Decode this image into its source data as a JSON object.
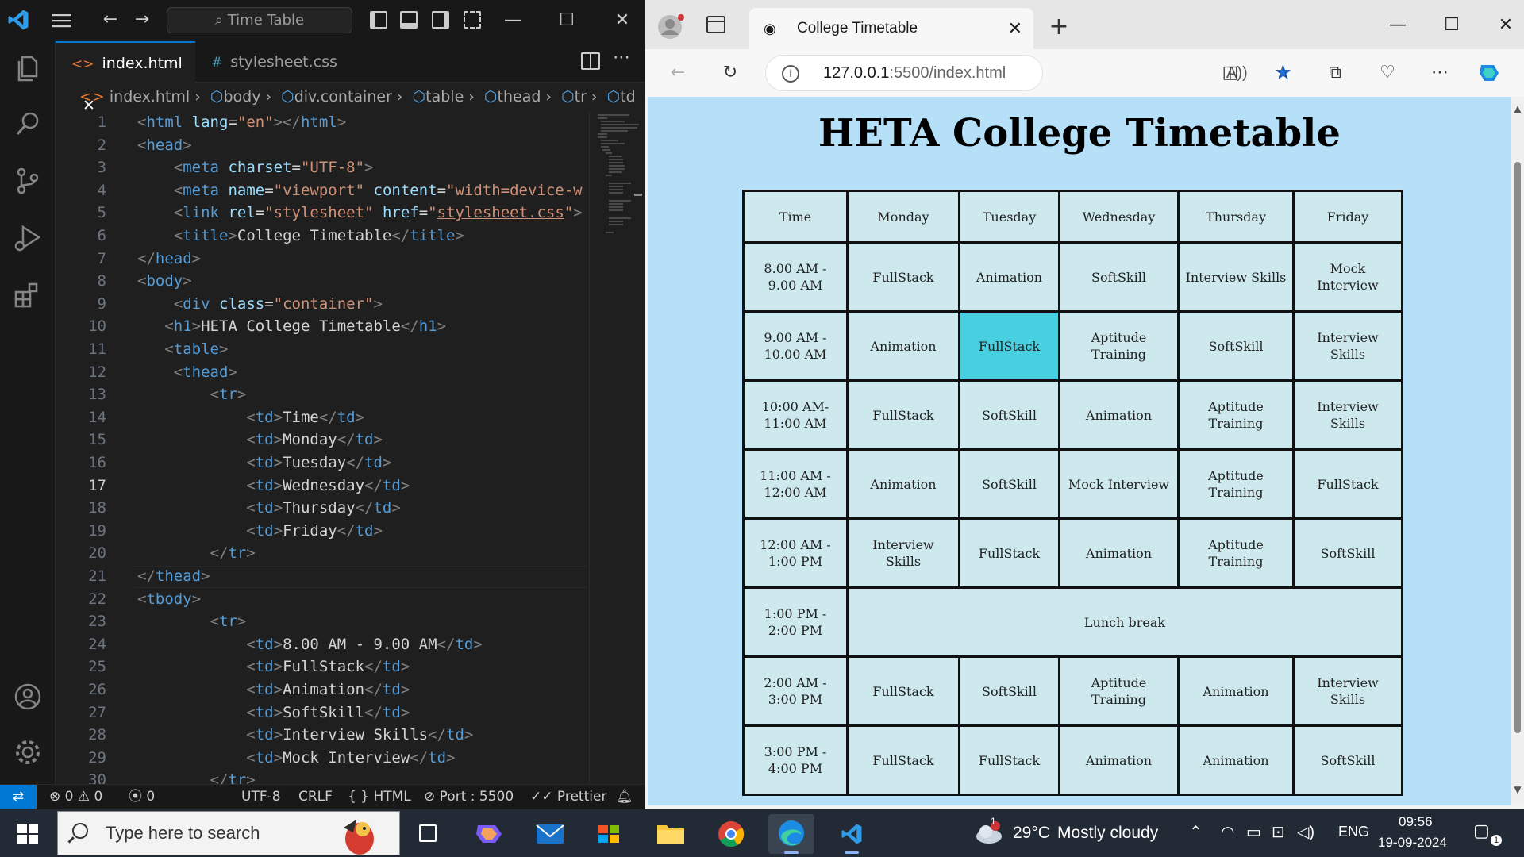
{
  "vscode": {
    "search": "Time Table",
    "tabs": [
      {
        "icon": "<>",
        "label": "index.html",
        "close": "✕"
      },
      {
        "icon": "#",
        "label": "stylesheet.css"
      }
    ],
    "breadcrumb": [
      "index.html",
      "body",
      "div.container",
      "table",
      "thead",
      "tr",
      "td"
    ],
    "lines": [
      "1",
      "2",
      "3",
      "4",
      "5",
      "6",
      "7",
      "8",
      "9",
      "10",
      "11",
      "12",
      "13",
      "14",
      "15",
      "16",
      "17",
      "18",
      "19",
      "20",
      "21",
      "22",
      "23",
      "24",
      "25",
      "26",
      "27",
      "28",
      "29",
      "30"
    ],
    "status": {
      "errors": "0",
      "warnings": "0",
      "ports": "0",
      "encoding": "UTF-8",
      "eol": "CRLF",
      "language": "HTML",
      "port": "Port : 5500",
      "formatter": "Prettier"
    }
  },
  "edge": {
    "tab_title": "College Timetable",
    "url_host": "127.0.0.1",
    "url_path": ":5500/index.html",
    "page": {
      "heading": "HETA College Timetable",
      "header": [
        "Time",
        "Monday",
        "Tuesday",
        "Wednesday",
        "Thursday",
        "Friday"
      ],
      "rows": [
        [
          "8.00 AM - 9.00 AM",
          "FullStack",
          "Animation",
          "SoftSkill",
          "Interview Skills",
          "Mock Interview"
        ],
        [
          "9.00 AM - 10.00 AM",
          "Animation",
          "FullStack",
          "Aptitude Training",
          "SoftSkill",
          "Interview Skills"
        ],
        [
          "10:00 AM- 11:00 AM",
          "FullStack",
          "SoftSkill",
          "Animation",
          "Aptitude Training",
          "Interview Skills"
        ],
        [
          "11:00 AM - 12:00 AM",
          "Animation",
          "SoftSkill",
          "Mock Interview",
          "Aptitude Training",
          "FullStack"
        ],
        [
          "12:00 AM - 1:00 PM",
          "Interview Skills",
          "FullStack",
          "Animation",
          "Aptitude Training",
          "SoftSkill"
        ],
        [
          "1:00 PM - 2:00 PM",
          "Lunch break"
        ],
        [
          "2:00 AM - 3:00 PM",
          "FullStack",
          "SoftSkill",
          "Aptitude Training",
          "Animation",
          "Interview Skills"
        ],
        [
          "3:00 PM - 4:00 PM",
          "FullStack",
          "FullStack",
          "Animation",
          "Animation",
          "SoftSkill"
        ]
      ]
    }
  },
  "taskbar": {
    "search_placeholder": "Type here to search",
    "weather_temp": "29°C",
    "weather_text": "Mostly cloudy",
    "weather_badge": "1",
    "language": "ENG",
    "time": "09:56",
    "date": "19-09-2024",
    "notif_count": "1"
  },
  "colors": {
    "vscode_bg": "#1f1f1f",
    "accent": "#0078d4",
    "page_bg": "#b6e0f7",
    "cell_bg": "#cde9ee",
    "cell_highlight": "#48d0e0"
  }
}
